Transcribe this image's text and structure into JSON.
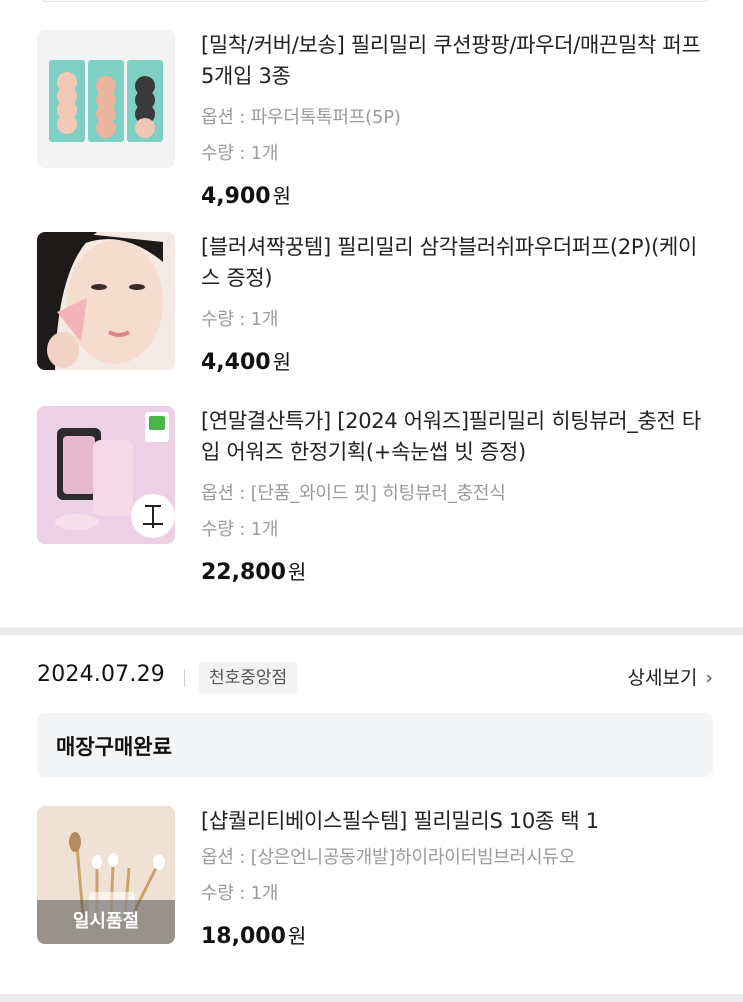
{
  "items": [
    {
      "title": "[밀착/커버/보송] 필리밀리 쿠션팡팡/파우더/매끈밀착 퍼프 5개입 3종",
      "option": "옵션 : 파우더톡톡퍼프(5P)",
      "qty": "수량 : 1개",
      "price": "4,900",
      "won": "원"
    },
    {
      "title": "[블러셔짝꿍템] 필리밀리 삼각블러쉬파우더퍼프(2P)(케이스 증정)",
      "qty": "수량 : 1개",
      "price": "4,400",
      "won": "원"
    },
    {
      "title": "[연말결산특가] [2024 어워즈]필리밀리 히팅뷰러_충전 타입 어워즈 한정기획(+속눈썹 빗 증정)",
      "option": "옵션 : [단품_와이드 핏] 히팅뷰러_충전식",
      "qty": "수량 : 1개",
      "price": "22,800",
      "won": "원"
    }
  ],
  "order": {
    "date": "2024.07.29",
    "store": "천호중앙점",
    "detail_label": "상세보기",
    "status": "매장구매완료",
    "item": {
      "title": "[샵퀄리티베이스필수템] 필리밀리S 10종 택 1",
      "option": "옵션 : [상은언니공동개발]하이라이터빔브러시듀오",
      "qty": "수량 : 1개",
      "price": "18,000",
      "won": "원",
      "badge": "일시품절"
    }
  },
  "colors": {
    "muted": "#9b9b9b",
    "divider": "#ebebee",
    "status_bg": "#f4f5f7"
  }
}
